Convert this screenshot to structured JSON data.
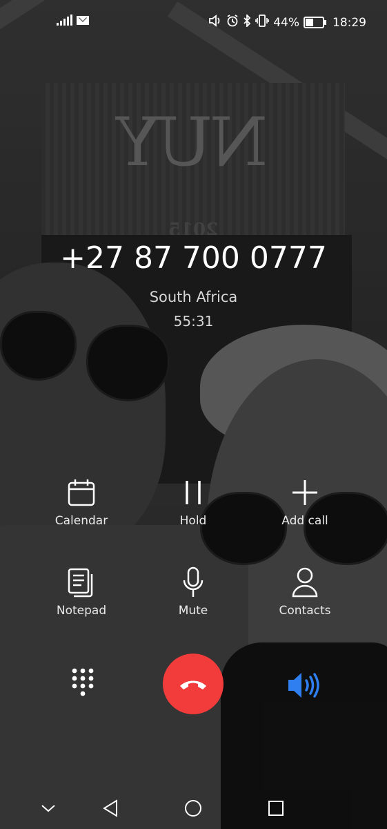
{
  "status_bar": {
    "battery_percent": "44%",
    "time": "18:29",
    "icons": [
      "signal-icon",
      "mail-icon",
      "volume-icon",
      "alarm-icon",
      "bluetooth-icon",
      "vibrate-icon",
      "battery-icon"
    ]
  },
  "call": {
    "number": "+27 87 700 0777",
    "location": "South Africa",
    "duration": "55:31"
  },
  "actions": [
    {
      "label": "Calendar",
      "icon": "calendar-icon"
    },
    {
      "label": "Hold",
      "icon": "pause-icon"
    },
    {
      "label": "Add call",
      "icon": "plus-icon"
    },
    {
      "label": "Notepad",
      "icon": "notepad-icon"
    },
    {
      "label": "Mute",
      "icon": "microphone-icon"
    },
    {
      "label": "Contacts",
      "icon": "person-icon"
    }
  ],
  "controls": {
    "hangup_color": "#f23b3b",
    "speaker_active_color": "#2f7ff0"
  },
  "background": {
    "sign_text": "NUY",
    "sign_year": "2015"
  }
}
